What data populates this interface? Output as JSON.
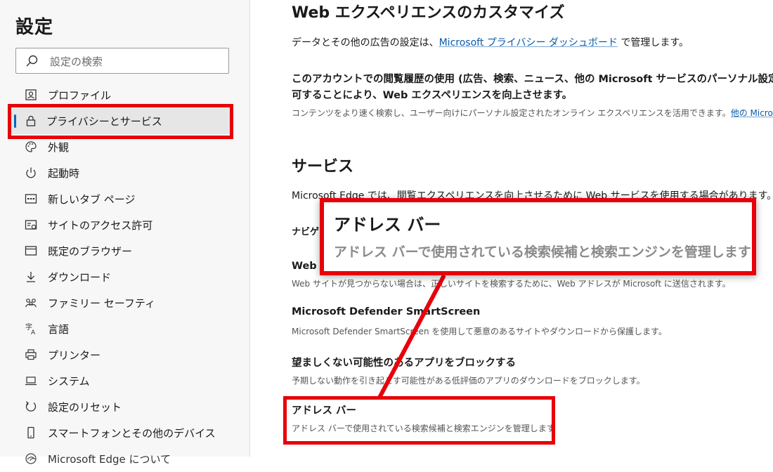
{
  "sidebar": {
    "title": "設定",
    "search": {
      "placeholder": "設定の検索",
      "value": ""
    },
    "items": [
      {
        "label": "プロファイル",
        "icon": "profile-icon"
      },
      {
        "label": "プライバシーとサービス",
        "icon": "lock-icon",
        "active": true
      },
      {
        "label": "外観",
        "icon": "palette-icon"
      },
      {
        "label": "起動時",
        "icon": "power-icon"
      },
      {
        "label": "新しいタブ ページ",
        "icon": "new-tab-icon"
      },
      {
        "label": "サイトのアクセス許可",
        "icon": "site-permissions-icon"
      },
      {
        "label": "既定のブラウザー",
        "icon": "browser-icon"
      },
      {
        "label": "ダウンロード",
        "icon": "download-icon"
      },
      {
        "label": "ファミリー セーフティ",
        "icon": "family-icon"
      },
      {
        "label": "言語",
        "icon": "language-icon"
      },
      {
        "label": "プリンター",
        "icon": "printer-icon"
      },
      {
        "label": "システム",
        "icon": "laptop-icon"
      },
      {
        "label": "設定のリセット",
        "icon": "reset-icon"
      },
      {
        "label": "スマートフォンとその他のデバイス",
        "icon": "phone-icon"
      },
      {
        "label": "Microsoft Edge について",
        "icon": "edge-icon"
      }
    ]
  },
  "main": {
    "web_section": {
      "title": "Web エクスペリエンスのカスタマイズ",
      "ad_text_before": "データとその他の広告の設定は、",
      "ad_link": "Microsoft プライバシー ダッシュボード",
      "ad_text_after": " で管理します。",
      "history_title_1": "このアカウントでの閲覧履歴の使用 (広告、検索、ニュース、他の Microsoft サービスのパーソナル設定を目的",
      "history_title_2": "可することにより、Web エクスペリエンスを向上させます。",
      "history_desc": "コンテンツをより速く検索し、ユーザー向けにパーソナル設定されたオンライン エクスペリエンスを活用できます。",
      "history_link": "他の Microsoft の広"
    },
    "services": {
      "title": "サービス",
      "intro": "Microsoft Edge では、閲覧エクスペリエンスを向上させるために Web サービスを使用する場合があります。この設",
      "nav_error_label": "ナビゲー",
      "web_label": "Web サ",
      "web_desc": "Web サイトが見つからない場合は、正しいサイトを検索するために、Web アドレスが Microsoft に送信されます。",
      "smartscreen_title": "Microsoft Defender SmartScreen",
      "smartscreen_desc": "Microsoft Defender SmartScreen を使用して悪意のあるサイトやダウンロードから保護します。",
      "pua_title": "望ましくない可能性のあるアプリをブロックする",
      "pua_desc": "予期しない動作を引き起こす可能性がある低評価のアプリのダウンロードをブロックします。",
      "address_title": "アドレス バー",
      "address_desc": "アドレス バーで使用されている検索候補と検索エンジンを管理します"
    }
  },
  "callout": {
    "title": "アドレス バー",
    "desc": "アドレス バーで使用されている検索候補と検索エンジンを管理します"
  },
  "colors": {
    "accent": "#0067c0",
    "highlight": "#e8000b",
    "link": "#0a5aa8"
  }
}
